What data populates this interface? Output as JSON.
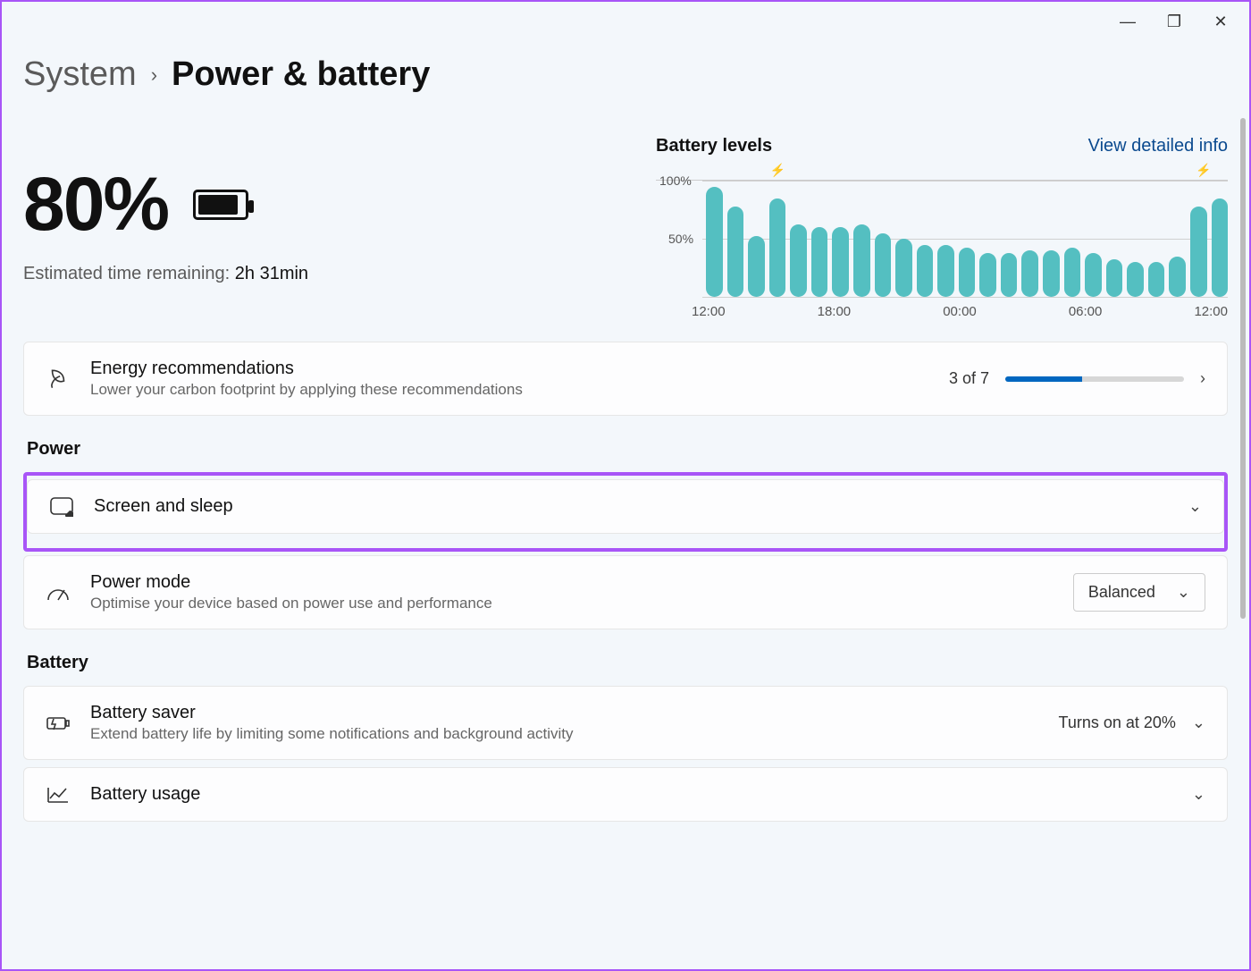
{
  "window_controls": {
    "minimize": "—",
    "maximize": "❐",
    "close": "✕"
  },
  "breadcrumb": {
    "parent": "System",
    "sep": "›",
    "current": "Power & battery"
  },
  "battery": {
    "percent": "80%",
    "estimate_label": "Estimated time remaining:",
    "estimate_value": "2h 31min"
  },
  "chart": {
    "title": "Battery levels",
    "link": "View detailed info",
    "y100": "100%",
    "y50": "50%",
    "xticks": [
      "12:00",
      "18:00",
      "00:00",
      "06:00",
      "12:00"
    ]
  },
  "chart_data": {
    "type": "bar",
    "title": "Battery levels",
    "ylabel": "%",
    "ylim": [
      0,
      100
    ],
    "categories": [
      "12:00",
      "13:00",
      "14:00",
      "15:00",
      "16:00",
      "17:00",
      "18:00",
      "19:00",
      "20:00",
      "21:00",
      "22:00",
      "23:00",
      "00:00",
      "01:00",
      "02:00",
      "03:00",
      "04:00",
      "05:00",
      "06:00",
      "07:00",
      "08:00",
      "09:00",
      "10:00",
      "11:00",
      "12:00"
    ],
    "values": [
      95,
      78,
      52,
      85,
      62,
      60,
      60,
      62,
      55,
      50,
      45,
      45,
      42,
      38,
      38,
      40,
      40,
      42,
      38,
      32,
      30,
      30,
      35,
      78,
      85
    ],
    "charging_at": [
      "15:00",
      "11:00"
    ]
  },
  "energy": {
    "title": "Energy recommendations",
    "sub": "Lower your carbon footprint by applying these recommendations",
    "count": "3 of 7",
    "progress_pct": 43
  },
  "sections": {
    "power": "Power",
    "battery": "Battery"
  },
  "screen_sleep": {
    "title": "Screen and sleep"
  },
  "power_mode": {
    "title": "Power mode",
    "sub": "Optimise your device based on power use and performance",
    "value": "Balanced"
  },
  "battery_saver": {
    "title": "Battery saver",
    "sub": "Extend battery life by limiting some notifications and background activity",
    "value": "Turns on at 20%"
  },
  "battery_usage": {
    "title": "Battery usage"
  }
}
